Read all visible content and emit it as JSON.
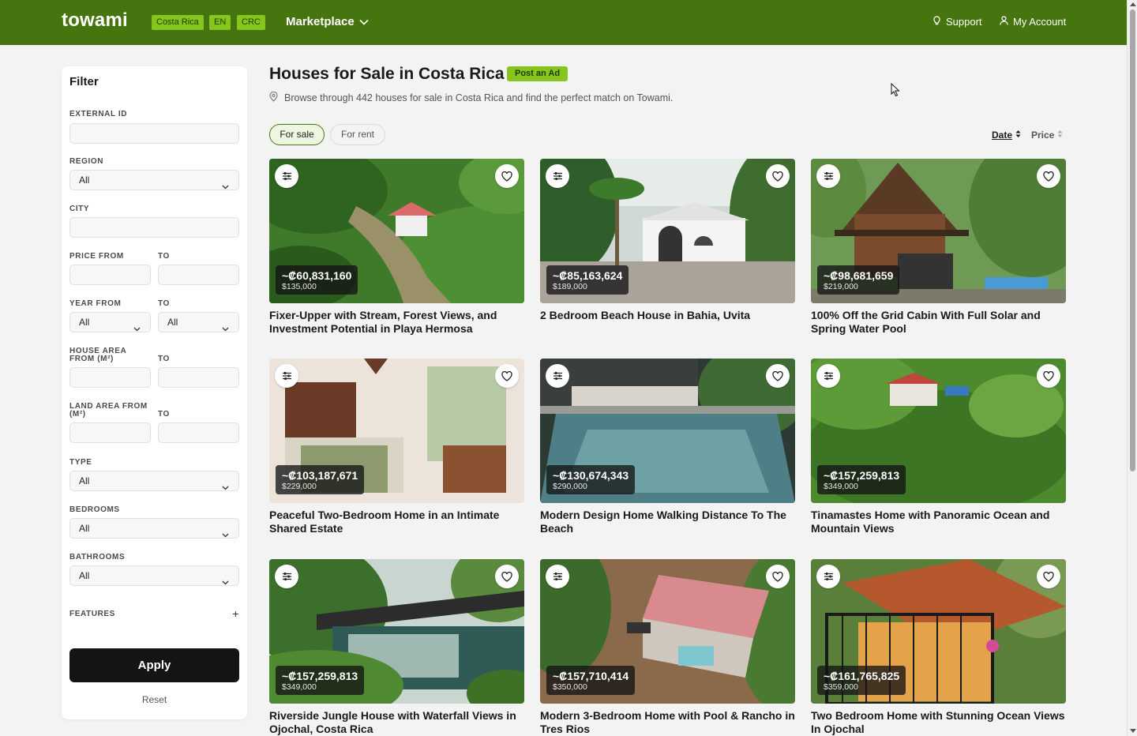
{
  "header": {
    "logo": "towami",
    "country": "Costa Rica",
    "language": "EN",
    "currency": "CRC",
    "marketplace": "Marketplace",
    "support": "Support",
    "account": "My Account",
    "brand_color": "#467510",
    "accent_color": "#86c51d"
  },
  "filter": {
    "title": "Filter",
    "external_id_label": "EXTERNAL ID",
    "region_label": "REGION",
    "region_value": "All",
    "city_label": "CITY",
    "price_from_label": "PRICE FROM",
    "price_to_label": "TO",
    "year_from_label": "YEAR FROM",
    "year_to_label": "TO",
    "year_from_value": "All",
    "year_to_value": "All",
    "house_area_from_label": "HOUSE AREA FROM (M²)",
    "house_area_to_label": "TO",
    "land_area_from_label": "LAND AREA FROM (M²)",
    "land_area_to_label": "TO",
    "type_label": "TYPE",
    "type_value": "All",
    "bedrooms_label": "BEDROOMS",
    "bedrooms_value": "All",
    "bathrooms_label": "BATHROOMS",
    "bathrooms_value": "All",
    "features_label": "FEATURES",
    "features_toggle": "+",
    "apply": "Apply",
    "reset": "Reset"
  },
  "main": {
    "title": "Houses for Sale in Costa Rica",
    "post_ad": "Post an Ad",
    "subtitle": "Browse through 442 houses for sale in Costa Rica and find the perfect match on Towami.",
    "tabs": [
      "For sale",
      "For rent"
    ],
    "active_tab": "For sale",
    "sort_date": "Date",
    "sort_price": "Price"
  },
  "listings": [
    {
      "crc": "~₡60,831,160",
      "usd": "$135,000",
      "title": "Fixer-Upper with Stream, Forest Views, and Investment Potential in Playa Hermosa"
    },
    {
      "crc": "~₡85,163,624",
      "usd": "$189,000",
      "title": "2 Bedroom Beach House in Bahia, Uvita"
    },
    {
      "crc": "~₡98,681,659",
      "usd": "$219,000",
      "title": "100% Off the Grid Cabin With Full Solar and Spring Water Pool"
    },
    {
      "crc": "~₡103,187,671",
      "usd": "$229,000",
      "title": "Peaceful Two-Bedroom Home in an Intimate Shared Estate"
    },
    {
      "crc": "~₡130,674,343",
      "usd": "$290,000",
      "title": "Modern Design Home Walking Distance To The Beach"
    },
    {
      "crc": "~₡157,259,813",
      "usd": "$349,000",
      "title": "Tinamastes Home with Panoramic Ocean and Mountain Views"
    },
    {
      "crc": "~₡157,259,813",
      "usd": "$349,000",
      "title": "Riverside Jungle House with Waterfall Views in Ojochal, Costa Rica"
    },
    {
      "crc": "~₡157,710,414",
      "usd": "$350,000",
      "title": "Modern 3-Bedroom Home with Pool & Rancho in Tres Rios"
    },
    {
      "crc": "~₡161,765,825",
      "usd": "$359,000",
      "title": "Two Bedroom Home with Stunning Ocean Views In Ojochal"
    }
  ]
}
